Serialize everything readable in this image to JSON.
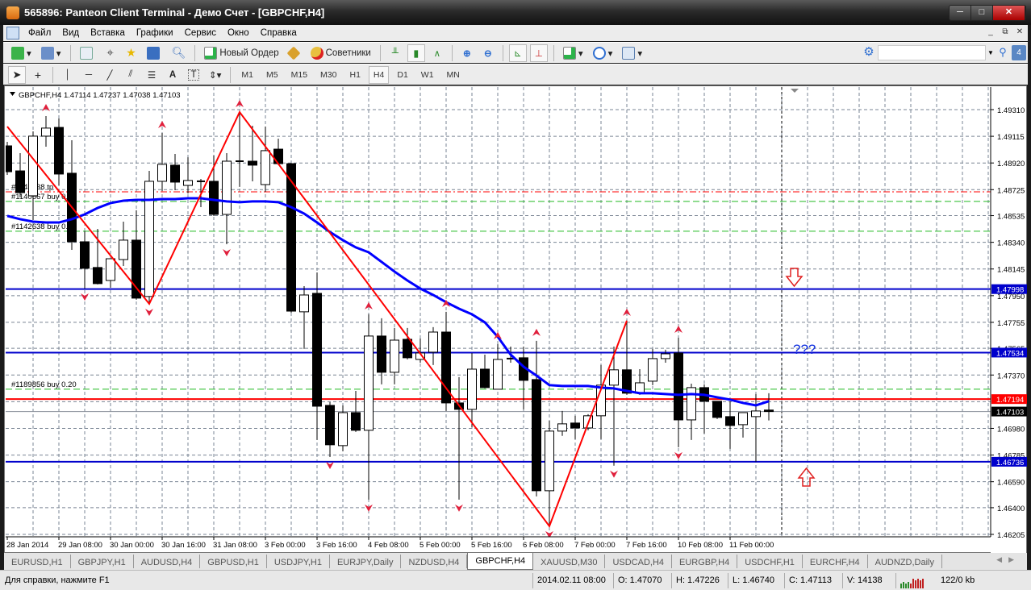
{
  "window": {
    "title": "565896: Panteon Client Terminal - Демо Счет - [GBPCHF,H4]"
  },
  "menu": [
    "Файл",
    "Вид",
    "Вставка",
    "Графики",
    "Сервис",
    "Окно",
    "Справка"
  ],
  "toolbar": {
    "new_order": "Новый Ордер",
    "experts": "Советники",
    "search_placeholder": "",
    "notifications": "4"
  },
  "timeframes": [
    "M1",
    "M5",
    "M15",
    "M30",
    "H1",
    "H4",
    "D1",
    "W1",
    "MN"
  ],
  "active_timeframe": "H4",
  "chart": {
    "header": "GBPCHF,H4  1.47114 1.47237 1.47038 1.47103",
    "price_ticks": [
      "1.49310",
      "1.49115",
      "1.48920",
      "1.48725",
      "1.48535",
      "1.48340",
      "1.48145",
      "1.47950",
      "1.47755",
      "1.47565",
      "1.47370",
      "1.46980",
      "1.46785",
      "1.46590",
      "1.46400",
      "1.46205"
    ],
    "time_labels": [
      "28 Jan 2014",
      "29 Jan 08:00",
      "30 Jan 00:00",
      "30 Jan 16:00",
      "31 Jan 08:00",
      "3 Feb 00:00",
      "3 Feb 16:00",
      "4 Feb 08:00",
      "5 Feb 00:00",
      "5 Feb 16:00",
      "6 Feb 08:00",
      "7 Feb 00:00",
      "7 Feb 16:00",
      "10 Feb 08:00",
      "11 Feb 00:00"
    ],
    "hlines": [
      {
        "price": "1.47998",
        "color": "#0000cc",
        "label": "1.47998"
      },
      {
        "price": "1.47534",
        "color": "#0000cc",
        "label": "1.47534"
      },
      {
        "price": "1.46736",
        "color": "#0000cc",
        "label": "1.46736"
      },
      {
        "price": "1.47194",
        "color": "#ff0000",
        "label": "1.47194"
      }
    ],
    "bid": {
      "price": "1.47103",
      "label": "1.47103"
    },
    "orders": [
      {
        "price": 1.48709,
        "color": "#ff0000",
        "label": "#1142638 tp"
      },
      {
        "price": 1.48639,
        "color": "#22bb22",
        "label": "#1140667 buy 0.20"
      },
      {
        "price": 1.48421,
        "color": "#22bb22",
        "label": "#1142638 buy 0.20"
      },
      {
        "price": 1.47266,
        "color": "#22bb22",
        "label": "#1189856 buy 0.20"
      }
    ],
    "annotation_text": "???",
    "colors": {
      "bull": "#ffffff",
      "bear": "#000000",
      "ma": "#0000ff",
      "zigzag": "#ff0000",
      "fractal": "#e0203c",
      "grid": "#7a8594"
    },
    "ohlc": [
      [
        1.49045,
        1.49074,
        1.48833,
        1.48856
      ],
      [
        1.48862,
        1.48992,
        1.48668,
        1.48703
      ],
      [
        1.4868,
        1.49151,
        1.48503,
        1.49116
      ],
      [
        1.49116,
        1.49263,
        1.49039,
        1.49175
      ],
      [
        1.4918,
        1.49245,
        1.48756,
        1.48839
      ],
      [
        1.48845,
        1.49086,
        1.48285,
        1.48344
      ],
      [
        1.48344,
        1.48421,
        1.48002,
        1.4815
      ],
      [
        1.48156,
        1.48438,
        1.48032,
        1.48038
      ],
      [
        1.48061,
        1.4822,
        1.48008,
        1.4822
      ],
      [
        1.48214,
        1.48491,
        1.48167,
        1.48356
      ],
      [
        1.48356,
        1.48574,
        1.4792,
        1.47932
      ],
      [
        1.47944,
        1.48862,
        1.4789,
        1.48786
      ],
      [
        1.48786,
        1.49139,
        1.48715,
        1.4891
      ],
      [
        1.48904,
        1.48986,
        1.48721,
        1.4878
      ],
      [
        1.48756,
        1.48962,
        1.48697,
        1.48792
      ],
      [
        1.48786,
        1.48803,
        1.48597,
        1.4878
      ],
      [
        1.48786,
        1.48974,
        1.48532,
        1.48544
      ],
      [
        1.48544,
        1.48992,
        1.48326,
        1.48933
      ],
      [
        1.48933,
        1.49292,
        1.48745,
        1.48927
      ],
      [
        1.48933,
        1.49192,
        1.48786,
        1.48904
      ],
      [
        1.48762,
        1.49186,
        1.48709,
        1.4901
      ],
      [
        1.49021,
        1.49098,
        1.48904,
        1.48915
      ],
      [
        1.48915,
        1.4892,
        1.47826,
        1.47837
      ],
      [
        1.47832,
        1.4802,
        1.47561,
        1.47955
      ],
      [
        1.47967,
        1.4812,
        1.46895,
        1.47142
      ],
      [
        1.47148,
        1.47172,
        1.46771,
        1.4686
      ],
      [
        1.46854,
        1.47148,
        1.46813,
        1.47095
      ],
      [
        1.47095,
        1.47254,
        1.46954,
        1.46966
      ],
      [
        1.46966,
        1.47814,
        1.46459,
        1.47655
      ],
      [
        1.47655,
        1.47785,
        1.47302,
        1.4739
      ],
      [
        1.4739,
        1.47714,
        1.47302,
        1.47625
      ],
      [
        1.47631,
        1.47714,
        1.47484,
        1.47496
      ],
      [
        1.47484,
        1.47637,
        1.4746,
        1.47531
      ],
      [
        1.47537,
        1.4772,
        1.47443,
        1.47684
      ],
      [
        1.47684,
        1.47832,
        1.47107,
        1.47166
      ],
      [
        1.47166,
        1.47355,
        1.46459,
        1.47119
      ],
      [
        1.47119,
        1.47531,
        1.46989,
        1.47413
      ],
      [
        1.47413,
        1.47519,
        1.47272,
        1.47278
      ],
      [
        1.47266,
        1.47596,
        1.47266,
        1.47484
      ],
      [
        1.4749,
        1.47578,
        1.4746,
        1.47484
      ],
      [
        1.47496,
        1.47578,
        1.47119,
        1.47331
      ],
      [
        1.47337,
        1.4762,
        1.46483,
        1.46524
      ],
      [
        1.46524,
        1.47036,
        1.46265,
        1.4696
      ],
      [
        1.4696,
        1.47107,
        1.46925,
        1.47013
      ],
      [
        1.47019,
        1.47072,
        1.46901,
        1.46983
      ],
      [
        1.46983,
        1.47084,
        1.46966,
        1.47072
      ],
      [
        1.47072,
        1.47443,
        1.46901,
        1.47296
      ],
      [
        1.47296,
        1.47578,
        1.46707,
        1.47408
      ],
      [
        1.47408,
        1.47767,
        1.47225,
        1.47237
      ],
      [
        1.47237,
        1.47413,
        1.47225,
        1.47313
      ],
      [
        1.47325,
        1.47561,
        1.47296,
        1.4749
      ],
      [
        1.4749,
        1.47555,
        1.4746,
        1.47525
      ],
      [
        1.47531,
        1.47643,
        1.46842,
        1.47042
      ],
      [
        1.47042,
        1.47307,
        1.46895,
        1.47278
      ],
      [
        1.47278,
        1.47302,
        1.46942,
        1.47178
      ],
      [
        1.47178,
        1.47178,
        1.47048,
        1.4706
      ],
      [
        1.47066,
        1.47178,
        1.4683,
        1.47001
      ],
      [
        1.47007,
        1.47095,
        1.46913,
        1.47095
      ],
      [
        1.47066,
        1.47231,
        1.46736,
        1.47107
      ],
      [
        1.47114,
        1.47237,
        1.47038,
        1.47103
      ]
    ],
    "ma": [
      1.48533,
      1.48509,
      1.48491,
      1.48485,
      1.48485,
      1.48509,
      1.48544,
      1.48591,
      1.48627,
      1.48644,
      1.4865,
      1.4865,
      1.48656,
      1.48656,
      1.48662,
      1.48662,
      1.4865,
      1.48639,
      1.48633,
      1.48639,
      1.48639,
      1.48633,
      1.48597,
      1.4855,
      1.48485,
      1.48415,
      1.48356,
      1.48303,
      1.48267,
      1.48197,
      1.48126,
      1.48061,
      1.48002,
      1.47955,
      1.47902,
      1.47855,
      1.47814,
      1.47755,
      1.47649,
      1.47519,
      1.47431,
      1.47366,
      1.47296,
      1.4729,
      1.4729,
      1.4729,
      1.47278,
      1.47272,
      1.47254,
      1.47237,
      1.47237,
      1.47231,
      1.47225,
      1.47231,
      1.47225,
      1.47207,
      1.4719,
      1.47166,
      1.47148,
      1.47178
    ],
    "zigzag": [
      [
        0,
        1.49186
      ],
      [
        11,
        1.4789
      ],
      [
        18,
        1.49292
      ],
      [
        42,
        1.46265
      ],
      [
        48,
        1.47767
      ]
    ],
    "fractals_up": [
      3,
      12,
      18,
      28,
      34,
      38,
      41,
      48,
      52
    ],
    "fractals_down": [
      6,
      11,
      17,
      25,
      28,
      35,
      42,
      47,
      52
    ]
  },
  "tabs": [
    "EURUSD,H1",
    "GBPJPY,H1",
    "AUDUSD,H4",
    "GBPUSD,H1",
    "USDJPY,H1",
    "EURJPY,Daily",
    "NZDUSD,H4",
    "GBPCHF,H4",
    "XAUUSD,M30",
    "USDCAD,H4",
    "EURGBP,H4",
    "USDCHF,H1",
    "EURCHF,H4",
    "AUDNZD,Daily"
  ],
  "active_tab": "GBPCHF,H4",
  "status": {
    "help": "Для справки, нажмите F1",
    "time": "2014.02.11 08:00",
    "open": "O: 1.47070",
    "high": "H: 1.47226",
    "low": "L: 1.46740",
    "close": "C: 1.47113",
    "volume": "V: 14138",
    "traffic": "122/0 kb"
  }
}
